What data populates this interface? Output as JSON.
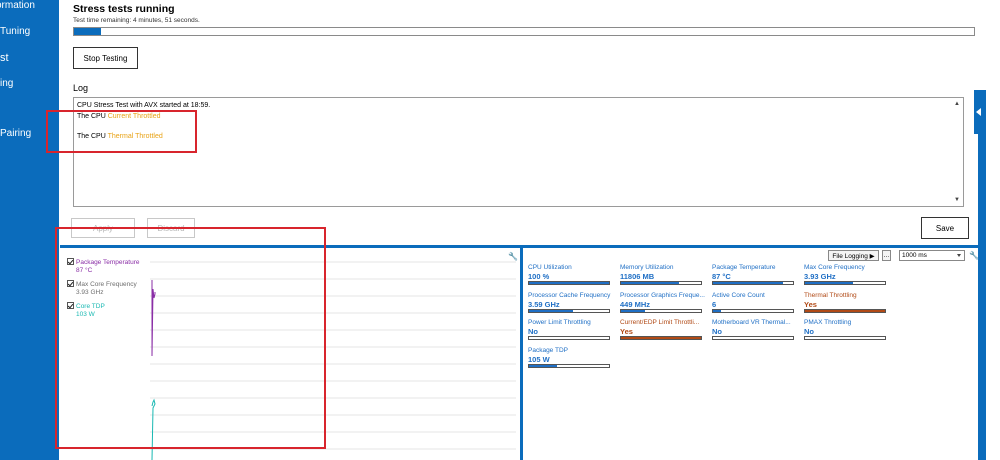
{
  "colors": {
    "accent": "#0b6cbc",
    "metric_blue": "#1f6fc5",
    "metric_orange": "#b14a16",
    "warning_orange": "#e8a317",
    "package_temp": "#8a2ea6",
    "core_freq": "#6e6e6e",
    "core_tdp": "#18b8b2",
    "annotation_red": "#d8252d"
  },
  "sidebar": {
    "items": [
      {
        "label": "ormation",
        "icon": null
      },
      {
        "label": "Tuning",
        "icon": null
      },
      {
        "label": "st",
        "icon": null
      },
      {
        "label": "ing",
        "icon": null
      },
      {
        "label": "Pairing",
        "icon": null
      }
    ]
  },
  "stress": {
    "title": "Stress tests running",
    "time_remaining": "Test time remaining: 4 minutes, 51 seconds.",
    "progress": 0.03,
    "stop_label": "Stop Testing"
  },
  "log": {
    "label": "Log",
    "lines": [
      {
        "prefix": "CPU Stress Test with AVX started at 18:59.",
        "highlight": ""
      },
      {
        "prefix": "The CPU ",
        "highlight": "Current Throttled"
      },
      {
        "prefix": "The CPU ",
        "highlight": "Thermal Throttled"
      }
    ]
  },
  "actions": {
    "apply_label": "Apply",
    "discard_label": "Discard",
    "save_label": "Save"
  },
  "graph": {
    "legend": [
      {
        "name": "Package Temperature",
        "value": "87 °C",
        "checked": true,
        "color_key": "package_temp"
      },
      {
        "name": "Max Core Frequency",
        "value": "3.93 GHz",
        "checked": true,
        "color_key": "core_freq"
      },
      {
        "name": "Core TDP",
        "value": "103 W",
        "checked": true,
        "color_key": "core_tdp"
      }
    ]
  },
  "monitor": {
    "file_logging_label": "File Logging ▶",
    "more_label": "...",
    "interval": "1000 ms",
    "metrics": [
      {
        "label": "CPU Utilization",
        "value": "100 %",
        "fill": 1.0,
        "alert": false
      },
      {
        "label": "Memory Utilization",
        "value": "11806  MB",
        "fill": 0.72,
        "alert": false
      },
      {
        "label": "Package Temperature",
        "value": "87 °C",
        "fill": 0.87,
        "alert": false
      },
      {
        "label": "Max Core Frequency",
        "value": "3.93 GHz",
        "fill": 0.6,
        "alert": false
      },
      {
        "label": "Processor Cache Frequency",
        "value": "3.59 GHz",
        "fill": 0.55,
        "alert": false
      },
      {
        "label": "Processor Graphics Freque...",
        "value": "449 MHz",
        "fill": 0.3,
        "alert": false
      },
      {
        "label": "Active Core Count",
        "value": "6",
        "fill": 0.1,
        "alert": false
      },
      {
        "label": "Thermal Throttling",
        "value": "Yes",
        "fill": 1.0,
        "alert": true
      },
      {
        "label": "Power Limit Throttling",
        "value": "No",
        "fill": 0.0,
        "alert": false
      },
      {
        "label": "Current/EDP Limit Throttli...",
        "value": "Yes",
        "fill": 1.0,
        "alert": true
      },
      {
        "label": "Motherboard VR Thermal...",
        "value": "No",
        "fill": 0.0,
        "alert": false
      },
      {
        "label": "PMAX Throttling",
        "value": "No",
        "fill": 0.0,
        "alert": false
      },
      {
        "label": "Package TDP",
        "value": "105 W",
        "fill": 0.35,
        "alert": false
      }
    ]
  }
}
